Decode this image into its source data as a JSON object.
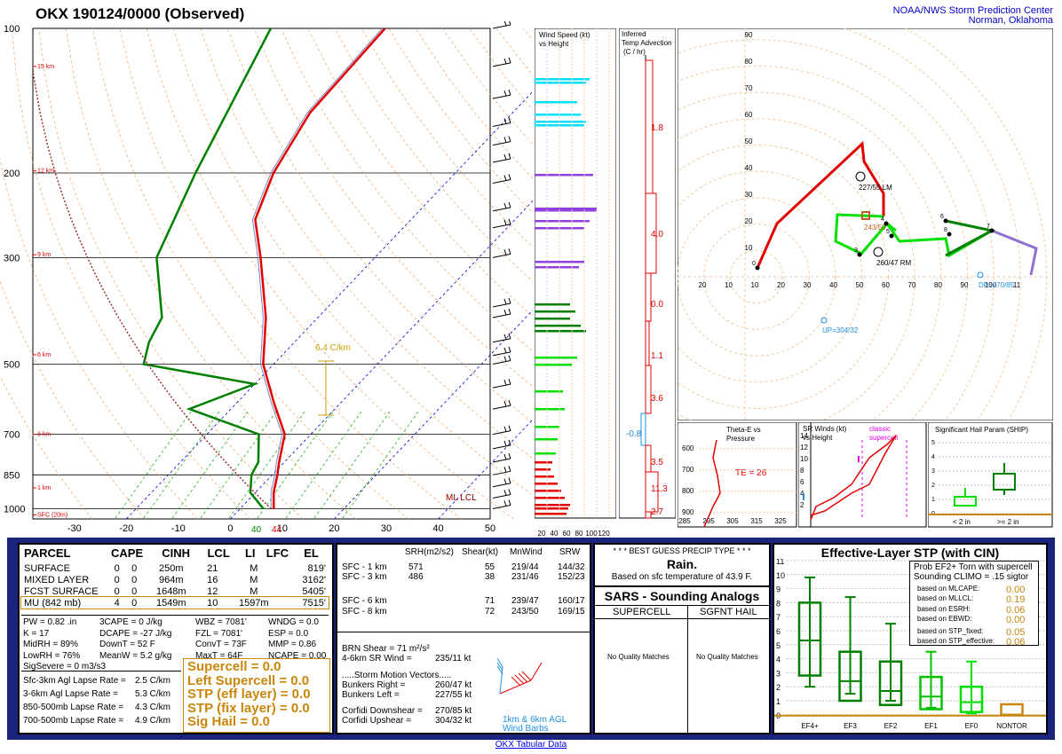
{
  "header": {
    "title": "OKX   190124/0000  (Observed)",
    "org_line1": "NOAA/NWS Storm Prediction Center",
    "org_line2": "Norman, Oklahoma"
  },
  "skewt": {
    "pressure_labels": [
      "100",
      "200",
      "300",
      "500",
      "700",
      "850",
      "1000"
    ],
    "pressure_values": [
      100,
      200,
      300,
      500,
      700,
      850,
      1000
    ],
    "height_labels": [
      "15 km",
      "12 km",
      "9 km",
      "6 km",
      "3 km",
      "1 km",
      "SFC (20m)"
    ],
    "temp_ticks": [
      "-30",
      "-20",
      "-10",
      "0",
      "10",
      "20",
      "30",
      "40",
      "50"
    ],
    "lapse_label": "6.4 C/km",
    "lcl_label": "ML  LCL",
    "sfc_temp_label": "44",
    "sfc_dew_label": "40"
  },
  "chart_data": {
    "type": "line",
    "title": "OKX   190124/0000  (Observed)",
    "x_axis": "Temperature (C), skewed",
    "y_axis": "Pressure (mb), log scale",
    "ylim": [
      1000,
      100
    ],
    "series": [
      {
        "name": "Temperature",
        "points": [
          [
            1000,
            6.5
          ],
          [
            925,
            3.5
          ],
          [
            850,
            1
          ],
          [
            800,
            -1
          ],
          [
            700,
            -5
          ],
          [
            600,
            -13
          ],
          [
            500,
            -22
          ],
          [
            400,
            -30
          ],
          [
            300,
            -42
          ],
          [
            250,
            -50
          ],
          [
            200,
            -55
          ],
          [
            150,
            -59
          ],
          [
            100,
            -60
          ]
        ]
      },
      {
        "name": "Dewpoint",
        "points": [
          [
            1000,
            4.5
          ],
          [
            925,
            -1
          ],
          [
            850,
            -4
          ],
          [
            800,
            -5
          ],
          [
            700,
            -10
          ],
          [
            620,
            -28
          ],
          [
            550,
            -20
          ],
          [
            500,
            -45
          ],
          [
            450,
            -48
          ],
          [
            400,
            -50
          ],
          [
            300,
            -62
          ],
          [
            200,
            -70
          ],
          [
            100,
            -82
          ]
        ]
      },
      {
        "name": "Wind speed vs height (kt)",
        "points": [
          [
            1,
            10
          ],
          [
            2,
            20
          ],
          [
            3,
            30
          ],
          [
            4,
            40
          ],
          [
            5,
            45
          ],
          [
            6,
            55
          ],
          [
            7,
            60
          ],
          [
            8,
            65
          ],
          [
            9,
            70
          ],
          [
            10,
            80
          ],
          [
            12,
            85
          ],
          [
            14,
            75
          ]
        ]
      }
    ]
  },
  "wind_speed_panel": {
    "title1": "Wind Speed (kt)",
    "title2": "vs Height",
    "ticks": [
      "20",
      "40",
      "60",
      "80",
      "100",
      "120"
    ]
  },
  "temp_adv_panel": {
    "title1": "Inferred",
    "title2": "Temp Advection",
    "title3": "(C / hr)",
    "values": [
      "1.8",
      "4.0",
      "0.0",
      "1.1",
      "3.6",
      "-0.8",
      "3.5",
      "11.3",
      "2.7"
    ]
  },
  "hodograph": {
    "x_ticks": [
      "20",
      "10",
      "10",
      "20",
      "30",
      "40",
      "50",
      "60",
      "70",
      "80",
      "90",
      "100",
      "11"
    ],
    "y_ticks": [
      "90",
      "80",
      "70",
      "60",
      "50",
      "40",
      "30",
      "20",
      "10"
    ],
    "lm_label": "227/55 LM",
    "rm_label": "260/47 RM",
    "mean_label": "243/50",
    "dp_label": "DP=270/85",
    "up_label": "UP=304/32",
    "points": [
      "0",
      "3",
      "4",
      "5",
      "6",
      "7",
      "8"
    ]
  },
  "thetae": {
    "title1": "Theta-E vs",
    "title2": "Pressure",
    "ticks": [
      "600",
      "700",
      "800",
      "900"
    ],
    "xticks": [
      "285",
      "295",
      "305",
      "315",
      "325"
    ],
    "te_label": "TE = 26"
  },
  "srwinds": {
    "title1": "SR Winds (kt)",
    "title2": "vs Height",
    "classic": "classic",
    "supercell": "supercell",
    "yticks": [
      "14",
      "12",
      "10",
      "8",
      "6",
      "4",
      "2"
    ],
    "xticks": [
      "0",
      "20",
      "40",
      "60",
      "80"
    ]
  },
  "ship": {
    "title": "Significant Hail Param (SHIP)",
    "yticks": [
      "5",
      "4",
      "3",
      "2",
      "1",
      "0"
    ],
    "lt": "< 2 in",
    "gt": ">= 2 in"
  },
  "parcel_table": {
    "headers": [
      "PARCEL",
      "CAPE",
      "CINH",
      "LCL",
      "LI",
      "LFC",
      "EL"
    ],
    "rows": [
      [
        "SURFACE",
        "0",
        "0",
        "250m",
        "21",
        "M",
        "819'"
      ],
      [
        "MIXED LAYER",
        "0",
        "0",
        "964m",
        "16",
        "M",
        "3162'"
      ],
      [
        "FCST SURFACE",
        "0",
        "0",
        "1648m",
        "12",
        "M",
        "5405'"
      ],
      [
        "MU  (842 mb)",
        "4",
        "0",
        "1549m",
        "10",
        "1597m",
        "7515'"
      ]
    ]
  },
  "indices": {
    "col1": [
      "PW = 0.82 .in",
      "K = 17",
      "MidRH = 89%",
      "LowRH = 76%",
      "SigSevere = 0 m3/s3"
    ],
    "col2": [
      "3CAPE = 0 J/kg",
      "DCAPE = -27 J/kg",
      "DownT = 52 F",
      "MeanW = 5.2 g/kg"
    ],
    "col3": [
      "WBZ = 7081'",
      "FZL = 7081'",
      "ConvT = 73F",
      "MaxT = 64F"
    ],
    "col4": [
      "WNDG = 0.0",
      "ESP = 0.0",
      "MMP = 0.86",
      "NCAPE = 0.00"
    ]
  },
  "lapse_rates": [
    [
      "Sfc-3km Agl Lapse Rate =",
      "2.5 C/km"
    ],
    [
      "3-6km Agl Lapse Rate =",
      "5.3 C/km"
    ],
    [
      "850-500mb Lapse Rate =",
      "4.3 C/km"
    ],
    [
      "700-500mb Lapse Rate =",
      "4.9 C/km"
    ]
  ],
  "composite": [
    "Supercell = 0.0",
    "Left Supercell = 0.0",
    "STP (eff layer) = 0.0",
    "STP (fix layer) = 0.0",
    "Sig Hail = 0.0"
  ],
  "kinematics": {
    "headers": [
      "SRH(m2/s2)",
      "Shear(kt)",
      "MnWind",
      "SRW"
    ],
    "rows": [
      [
        "SFC - 1 km",
        "571",
        "55",
        "219/44",
        "144/32"
      ],
      [
        "SFC - 3 km",
        "486",
        "38",
        "231/46",
        "152/23"
      ],
      [
        "SFC - 6 km",
        "",
        "71",
        "239/47",
        "160/17"
      ],
      [
        "SFC - 8 km",
        "",
        "72",
        "243/50",
        "169/15"
      ]
    ],
    "brn": "BRN Shear =  71 m²/s²",
    "sr46": "4-6km SR Wind =",
    "sr46_val": "235/11 kt",
    "storm_title": ".....Storm Motion Vectors.....",
    "motions": [
      [
        "Bunkers Right =",
        "260/47 kt"
      ],
      [
        "Bunkers Left =",
        "227/55 kt"
      ],
      [
        "Corfidi Downshear =",
        "270/85 kt"
      ],
      [
        "Corfidi Upshear =",
        "304/32 kt"
      ]
    ],
    "barb_label1": "1km & 6km AGL",
    "barb_label2": "Wind Barbs"
  },
  "precip": {
    "title": "* * * BEST GUESS PRECIP TYPE * * *",
    "value": "Rain.",
    "note": "Based on sfc temperature of 43.9 F."
  },
  "sars": {
    "title": "SARS - Sounding Analogs",
    "col1": "SUPERCELL",
    "col2": "SGFNT HAIL",
    "no1": "No Quality Matches",
    "no2": "No Quality Matches"
  },
  "stp": {
    "title": "Effective-Layer STP (with CIN)",
    "prob_title": "Prob EF2+ Torn with supercell",
    "climo": "Sounding CLIMO = .15 sigtor",
    "rows": [
      [
        "based on MLCAPE:",
        "0.00"
      ],
      [
        "based on MLLCL:",
        "0.19"
      ],
      [
        "based on ESRH:",
        "0.06"
      ],
      [
        "based on EBWD:",
        "0.00"
      ],
      [
        "based on STP_fixed:",
        "0.05"
      ],
      [
        "based on STP_effective:",
        "0.06"
      ]
    ],
    "yticks": [
      "11",
      "10",
      "9",
      "8",
      "7",
      "6",
      "5",
      "4",
      "3",
      "2",
      "1",
      "0"
    ],
    "cats": [
      "EF4+",
      "EF3",
      "EF2",
      "EF1",
      "EF0",
      "NONTOR"
    ]
  },
  "footer": {
    "link": "OKX Tabular Data"
  }
}
